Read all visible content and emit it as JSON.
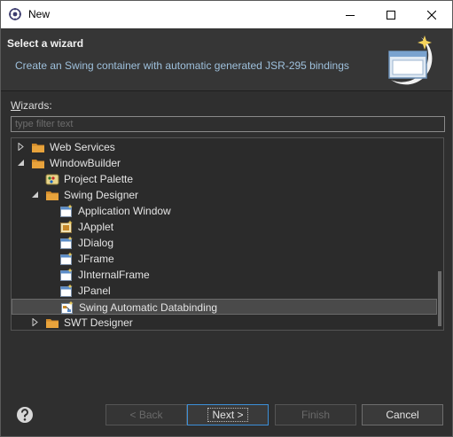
{
  "window": {
    "title": "New",
    "icon": "eclipse-new-icon"
  },
  "header": {
    "title": "Select a wizard",
    "description": "Create an Swing container with automatic generated JSR-295 bindings",
    "image": "wizard-banner-icon"
  },
  "wizards_label": {
    "accel": "W",
    "rest": "izards:"
  },
  "filter": {
    "placeholder": "type filter text"
  },
  "tree": {
    "items": [
      {
        "label": "Web Services",
        "icon": "folder-icon",
        "expanded": false
      },
      {
        "label": "WindowBuilder",
        "icon": "folder-icon",
        "expanded": true
      },
      {
        "label": "Project Palette",
        "icon": "palette-icon"
      },
      {
        "label": "Swing Designer",
        "icon": "folder-icon",
        "expanded": true
      },
      {
        "label": "Application Window",
        "icon": "window-icon"
      },
      {
        "label": "JApplet",
        "icon": "applet-icon"
      },
      {
        "label": "JDialog",
        "icon": "window-icon"
      },
      {
        "label": "JFrame",
        "icon": "window-icon"
      },
      {
        "label": "JInternalFrame",
        "icon": "window-icon"
      },
      {
        "label": "JPanel",
        "icon": "window-icon"
      },
      {
        "label": "Swing Automatic Databinding",
        "icon": "databinding-icon",
        "selected": true
      },
      {
        "label": "SWT Designer",
        "icon": "folder-icon",
        "expanded": false
      }
    ]
  },
  "buttons": {
    "back": "< Back",
    "next": "Next >",
    "finish": "Finish",
    "cancel": "Cancel"
  },
  "colors": {
    "accent": "#3c8fd8",
    "description": "#9ec0dc",
    "folder": "#e8a33c"
  }
}
